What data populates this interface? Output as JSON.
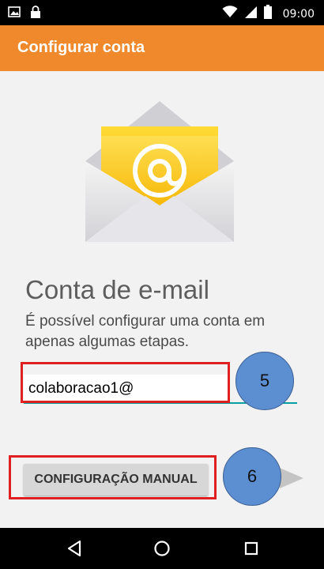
{
  "status_bar": {
    "time": "09:00",
    "icons": [
      "image-icon",
      "lock-icon",
      "wifi-icon",
      "signal-icon",
      "battery-icon"
    ]
  },
  "app_bar": {
    "title": "Configurar conta",
    "color": "#f0892b"
  },
  "main": {
    "heading": "Conta de e-mail",
    "description": "É possível configurar uma conta em apenas algumas etapas.",
    "email_value": "colaboracao1@",
    "manual_button_label": "CONFIGURAÇÃO MANUAL",
    "accent_color": "#00a0a0"
  },
  "annotations": {
    "step_5": "5",
    "step_6": "6",
    "highlight_color": "#e02020",
    "circle_color": "#5b8fd1"
  },
  "nav_bar": {
    "icons": [
      "back-icon",
      "home-icon",
      "recent-apps-icon"
    ]
  }
}
